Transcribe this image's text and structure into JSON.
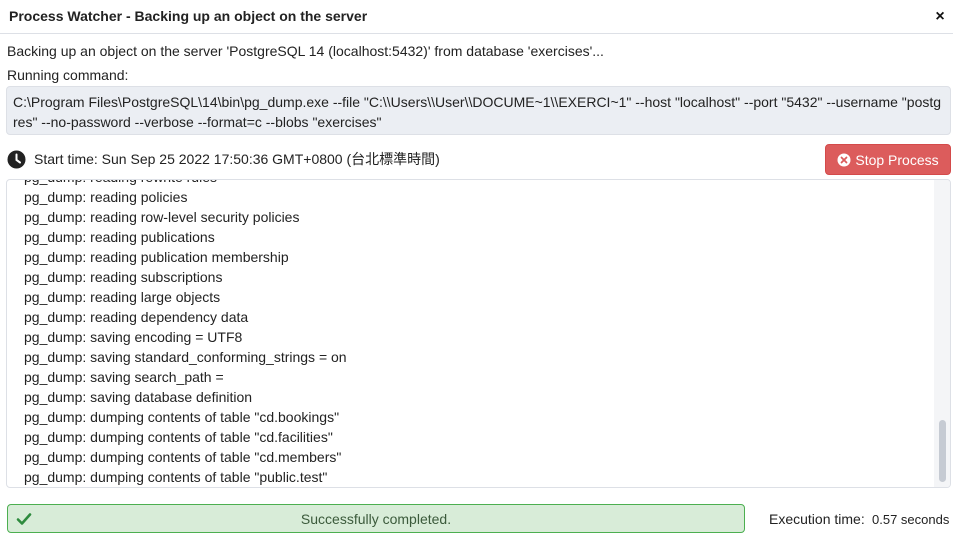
{
  "window": {
    "title": "Process Watcher - Backing up an object on the server",
    "close_glyph": "×"
  },
  "description": "Backing up an object on the server 'PostgreSQL 14 (localhost:5432)' from database 'exercises'...",
  "running_label": "Running command:",
  "command": "C:\\Program Files\\PostgreSQL\\14\\bin\\pg_dump.exe --file \"C:\\\\Users\\\\User\\\\DOCUME~1\\\\EXERCI~1\" --host \"localhost\" --port \"5432\" --username \"postgres\" --no-password --verbose --format=c --blobs \"exercises\"",
  "start_time_label": "Start time: Sun Sep 25 2022 17:50:36 GMT+0800 (台北標準時間)",
  "stop_button_label": "Stop Process",
  "log_lines": [
    "pg_dump: reading rewrite rules",
    "pg_dump: reading policies",
    "pg_dump: reading row-level security policies",
    "pg_dump: reading publications",
    "pg_dump: reading publication membership",
    "pg_dump: reading subscriptions",
    "pg_dump: reading large objects",
    "pg_dump: reading dependency data",
    "pg_dump: saving encoding = UTF8",
    "pg_dump: saving standard_conforming_strings = on",
    "pg_dump: saving search_path =",
    "pg_dump: saving database definition",
    "pg_dump: dumping contents of table \"cd.bookings\"",
    "pg_dump: dumping contents of table \"cd.facilities\"",
    "pg_dump: dumping contents of table \"cd.members\"",
    "pg_dump: dumping contents of table \"public.test\""
  ],
  "status_text": "Successfully completed.",
  "execution_time_label": "Execution time:",
  "execution_time_value": "0.57 seconds",
  "icons": {
    "clock": "clock-icon",
    "stop": "times-circle-icon",
    "check": "check-icon"
  },
  "colors": {
    "stop_button": "#dc5c5c",
    "success_background": "#d8ecd8",
    "success_border": "#4caf50",
    "check": "#2e8b3e"
  }
}
